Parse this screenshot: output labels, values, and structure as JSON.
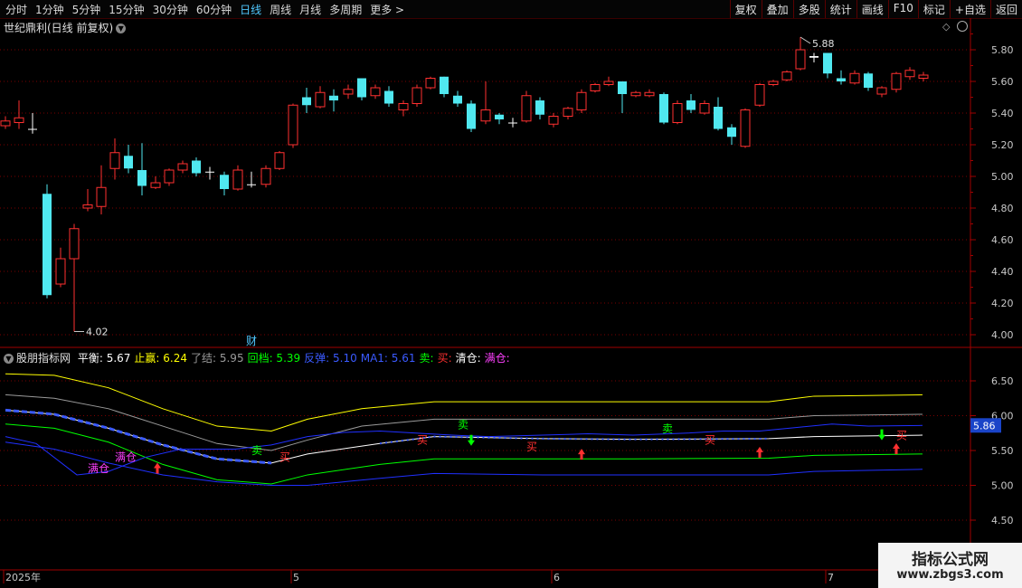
{
  "toolbar": {
    "periods": [
      "分时",
      "1分钟",
      "5分钟",
      "15分钟",
      "30分钟",
      "60分钟",
      "日线",
      "周线",
      "月线",
      "多周期",
      "更多 >"
    ],
    "active_index": 6,
    "right_buttons": [
      "复权",
      "叠加",
      "多股",
      "统计",
      "画线",
      "F10",
      "标记",
      "+自选",
      "返回"
    ]
  },
  "title": "世纪鼎利(日线 前复权)",
  "price_axis": [
    "5.80",
    "5.60",
    "5.40",
    "5.20",
    "5.00",
    "4.80",
    "4.60",
    "4.40",
    "4.20",
    "4.00"
  ],
  "high_label": "5.88",
  "low_label": "4.02",
  "fin_marker": "财",
  "indicator": {
    "name": "股朋指标网",
    "items": [
      {
        "label": "平衡:",
        "value": "5.67",
        "color": "#ffffff"
      },
      {
        "label": "止赢:",
        "value": "6.24",
        "color": "#ffff00"
      },
      {
        "label": "了结:",
        "value": "5.95",
        "color": "#9a9a9a"
      },
      {
        "label": "回档:",
        "value": "5.39",
        "color": "#00ff00"
      },
      {
        "label": "反弹:",
        "value": "5.10",
        "color": "#3a5aff"
      },
      {
        "label": "MA1:",
        "value": "5.61",
        "color": "#3a5aff"
      },
      {
        "label": "卖:",
        "value": "",
        "color": "#00ff00"
      },
      {
        "label": "买:",
        "value": "",
        "color": "#ff3030"
      },
      {
        "label": "清仓:",
        "value": "",
        "color": "#ffffff"
      },
      {
        "label": "满仓:",
        "value": "",
        "color": "#ff40ff"
      }
    ],
    "axis": [
      "6.50",
      "6.00",
      "5.50",
      "5.00",
      "4.50"
    ],
    "current": "5.86"
  },
  "signals": {
    "sell": "卖",
    "buy": "买",
    "full": "满仓"
  },
  "dates": [
    "2025年",
    "5",
    "6",
    "7"
  ],
  "colors": {
    "up": "#ff3030",
    "down": "#50e8f0",
    "grid": "#7a0000"
  },
  "watermark": {
    "line1": "指标公式网",
    "line2": "www.zbgs3.com"
  }
}
